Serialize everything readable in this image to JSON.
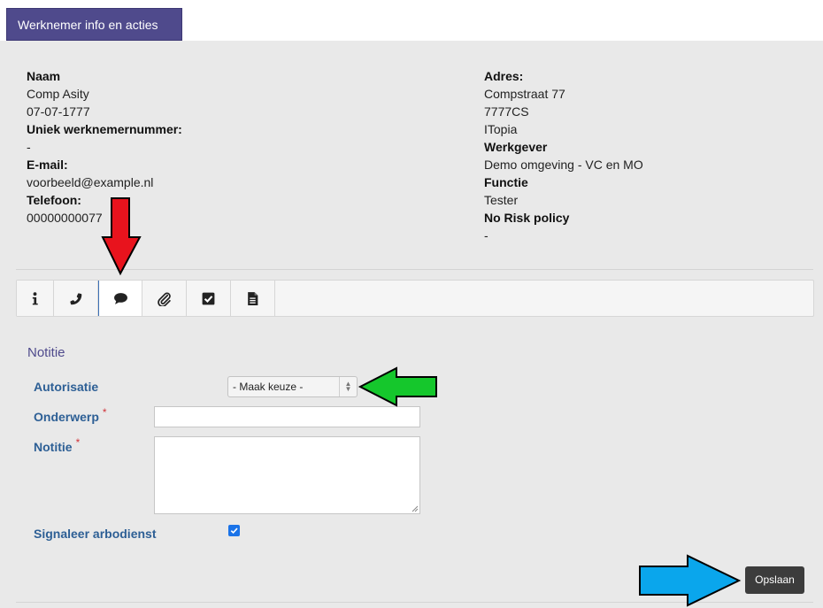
{
  "tab": {
    "title": "Werknemer info en acties"
  },
  "employee": {
    "left": [
      {
        "label": "Naam",
        "values": [
          "Comp Asity",
          "07-07-1777"
        ]
      },
      {
        "label": "Uniek werknemernummer:",
        "values": [
          "-"
        ]
      },
      {
        "label": "E-mail:",
        "values": [
          "voorbeeld@example.nl"
        ]
      },
      {
        "label": "Telefoon:",
        "values": [
          "00000000077"
        ]
      }
    ],
    "right": [
      {
        "label": "Adres:",
        "values": [
          "Compstraat 77",
          "7777CS",
          "ITopia"
        ]
      },
      {
        "label": "Werkgever",
        "values": [
          "Demo omgeving - VC en MO"
        ]
      },
      {
        "label": "Functie",
        "values": [
          "Tester"
        ]
      },
      {
        "label": "No Risk policy",
        "values": [
          "-"
        ]
      }
    ]
  },
  "toolbar": {
    "buttons": [
      {
        "icon": "info-icon"
      },
      {
        "icon": "phone-icon"
      },
      {
        "icon": "comment-icon",
        "active": true
      },
      {
        "icon": "paperclip-icon"
      },
      {
        "icon": "checkbox-icon"
      },
      {
        "icon": "document-icon"
      }
    ]
  },
  "form": {
    "section_title": "Notitie",
    "autorisatie_label": "Autorisatie",
    "autorisatie_value": "- Maak keuze -",
    "onderwerp_label": "Onderwerp",
    "notitie_label": "Notitie",
    "required_mark": "*",
    "signaleer_label": "Signaleer arbodienst",
    "signaleer_checked": true,
    "save_label": "Opslaan"
  },
  "colors": {
    "header": "#4f4a8c",
    "label_blue": "#2d5f95",
    "arrow_red": "#e8131d",
    "arrow_green": "#15c72c",
    "arrow_blue": "#0aa6ec",
    "save_button": "#3c3c3c"
  }
}
